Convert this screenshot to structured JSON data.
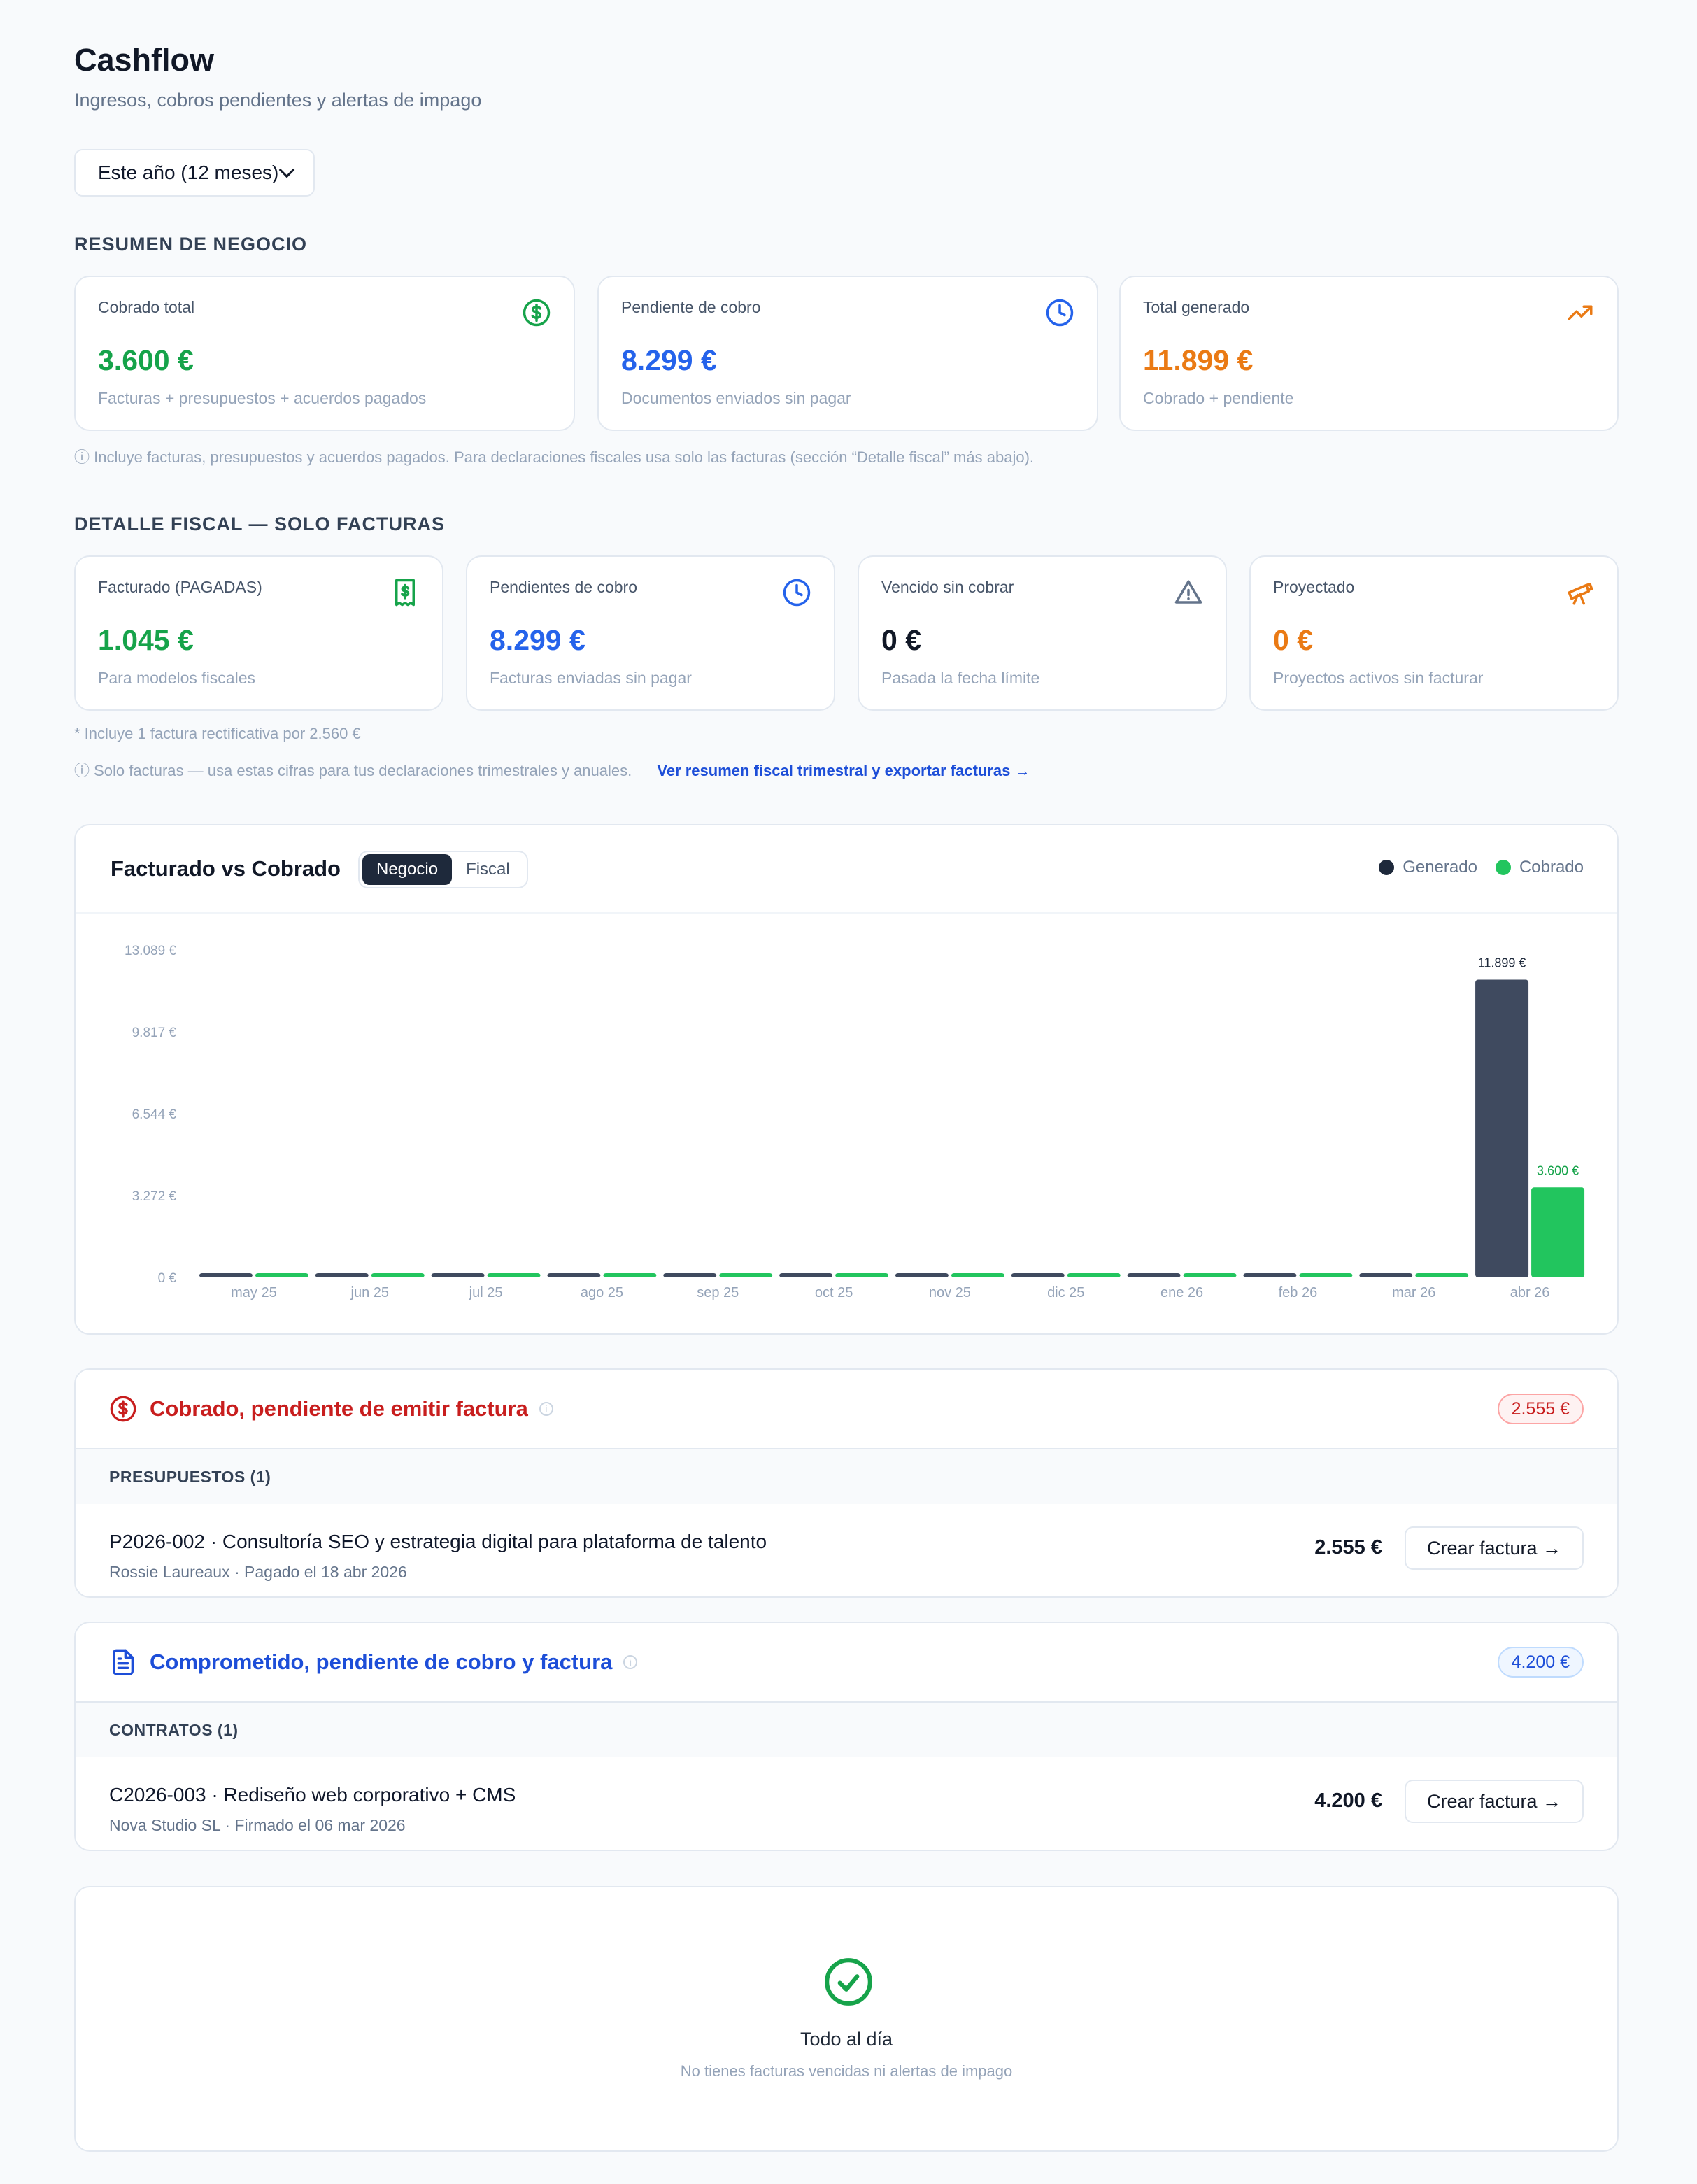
{
  "header": {
    "title": "Cashflow",
    "subtitle": "Ingresos, cobros pendientes y alertas de impago"
  },
  "period_select": {
    "value": "Este año (12 meses)"
  },
  "business_summary": {
    "label": "RESUMEN DE NEGOCIO",
    "cards": [
      {
        "label": "Cobrado total",
        "value": "3.600 €",
        "sub": "Facturas + presupuestos + acuerdos pagados",
        "icon": "dollar-circle-icon",
        "color": "#16a34a"
      },
      {
        "label": "Pendiente de cobro",
        "value": "8.299 €",
        "sub": "Documentos enviados sin pagar",
        "icon": "clock-icon",
        "color": "#2563eb"
      },
      {
        "label": "Total generado",
        "value": "11.899 €",
        "sub": "Cobrado + pendiente",
        "icon": "trending-up-icon",
        "color": "#ea7a14"
      }
    ],
    "note": "ⓘ Incluye facturas, presupuestos y acuerdos pagados. Para declaraciones fiscales usa solo las facturas (sección “Detalle fiscal” más abajo)."
  },
  "fiscal_detail": {
    "label": "DETALLE FISCAL — SOLO FACTURAS",
    "cards": [
      {
        "label": "Facturado (PAGADAS)",
        "value": "1.045 €",
        "sub": "Para modelos fiscales",
        "icon": "receipt-icon",
        "color": "#16a34a"
      },
      {
        "label": "Pendientes de cobro",
        "value": "8.299 €",
        "sub": "Facturas enviadas sin pagar",
        "icon": "clock-icon",
        "color": "#2563eb"
      },
      {
        "label": "Vencido sin cobrar",
        "value": "0 €",
        "sub": "Pasada la fecha límite",
        "icon": "warning-icon",
        "color": "#111827"
      },
      {
        "label": "Proyectado",
        "value": "0 €",
        "sub": "Proyectos activos sin facturar",
        "icon": "telescope-icon",
        "color": "#ea7a14"
      }
    ],
    "footnote": "* Incluye 1 factura rectificativa por 2.560 €",
    "note": "ⓘ Solo facturas — usa estas cifras para tus declaraciones trimestrales y anuales.",
    "link": "Ver resumen fiscal trimestral y exportar facturas →"
  },
  "chart": {
    "title": "Facturado vs Cobrado",
    "toggle": [
      "Negocio",
      "Fiscal"
    ],
    "active_toggle": "Negocio",
    "legend": [
      {
        "name": "Generado",
        "color": "#1e293b"
      },
      {
        "name": "Cobrado",
        "color": "#22c55e"
      }
    ]
  },
  "chart_data": {
    "type": "bar",
    "categories": [
      "may 25",
      "jun 25",
      "jul 25",
      "ago 25",
      "sep 25",
      "oct 25",
      "nov 25",
      "dic 25",
      "ene 26",
      "feb 26",
      "mar 26",
      "abr 26"
    ],
    "series": [
      {
        "name": "Generado",
        "color": "#3f4a5f",
        "values": [
          0,
          0,
          0,
          0,
          0,
          0,
          0,
          0,
          0,
          0,
          0,
          11899
        ]
      },
      {
        "name": "Cobrado",
        "color": "#22c55e",
        "values": [
          0,
          0,
          0,
          0,
          0,
          0,
          0,
          0,
          0,
          0,
          0,
          3600
        ]
      }
    ],
    "data_labels": [
      {
        "series": "Generado",
        "category": "abr 26",
        "text": "11.899 €"
      },
      {
        "series": "Cobrado",
        "category": "abr 26",
        "text": "3.600 €"
      }
    ],
    "y_ticks": [
      {
        "value": 0,
        "label": "0 €"
      },
      {
        "value": 3272,
        "label": "3.272 €"
      },
      {
        "value": 6544,
        "label": "6.544 €"
      },
      {
        "value": 9817,
        "label": "9.817 €"
      },
      {
        "value": 13089,
        "label": "13.089 €"
      }
    ],
    "ylim": [
      0,
      13089
    ],
    "grid": false,
    "legend_position": "top-right"
  },
  "pending_invoice": {
    "title": "Cobrado, pendiente de emitir factura",
    "total": "2.555 €",
    "group": "PRESUPUESTOS (1)",
    "item": {
      "title": "P2026-002 · Consultoría SEO y estrategia digital para plataforma de talento",
      "sub": "Rossie Laureaux · Pagado el 18 abr 2026",
      "amount": "2.555 €",
      "action": "Crear factura →"
    }
  },
  "committed": {
    "title": "Comprometido, pendiente de cobro y factura",
    "total": "4.200 €",
    "group": "CONTRATOS (1)",
    "item": {
      "title": "C2026-003 · Rediseño web corporativo + CMS",
      "sub": "Nova Studio SL · Firmado el 06 mar 2026",
      "amount": "4.200 €",
      "action": "Crear factura →"
    }
  },
  "status": {
    "title": "Todo al día",
    "sub": "No tienes facturas vencidas ni alertas de impago"
  }
}
